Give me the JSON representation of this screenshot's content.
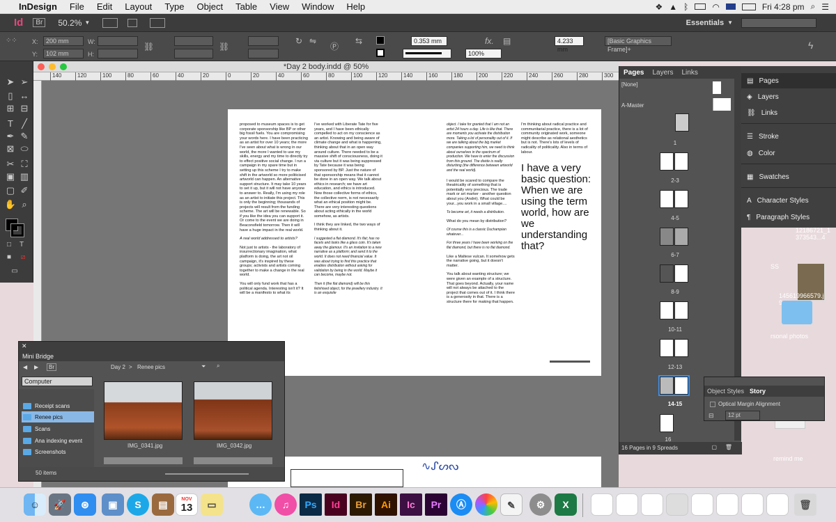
{
  "menubar": {
    "apple": "",
    "app": "InDesign",
    "items": [
      "File",
      "Edit",
      "Layout",
      "Type",
      "Object",
      "Table",
      "View",
      "Window",
      "Help"
    ],
    "battery": "",
    "flag": "",
    "clock": "Fri 4:28 pm"
  },
  "appbar": {
    "id": "Id",
    "br": "Br",
    "zoom": "50.2%",
    "workspace": "Essentials",
    "search_placeholder": ""
  },
  "control": {
    "x_label": "X:",
    "x_value": "200 mm",
    "y_label": "Y:",
    "y_value": "102 mm",
    "w_label": "W:",
    "h_label": "H:",
    "stroke_weight": "0.353 mm",
    "opacity": "100%",
    "frame_size": "4.233 mm",
    "object_style": "[Basic Graphics Frame]+"
  },
  "doc": {
    "title": "*Day 2 body.indd @ 50%",
    "ruler_ticks": [
      "140",
      "120",
      "100",
      "80",
      "60",
      "40",
      "20",
      "0",
      "20",
      "40",
      "60",
      "80",
      "100",
      "120",
      "140",
      "160",
      "180",
      "200",
      "220",
      "240",
      "260",
      "280",
      "300"
    ]
  },
  "page_left": {
    "col1": "proposed to museum spaces is to get corporate sponsorship like BP or other big fossil fuels. You are compromising your words here. I have been practicing as an artist for over 10 years; the more I've seen about what is wrong in our world, the more I wanted to use my skills, energy and my time to directly try to effect positive social change. I run a campaign in my spare time but in setting up this scheme I try to make shift in the artworld so more politicised artworld can happen. An alternative support structure. It may take 10 years to set it up, but it will not have anyone to answer to. Really, I'm using my role as an artist to initiate this project. This is only the beginning; thousands of projects will result from the funding scheme. The art will be renewable. So if you like the idea you can support it. Or come to the event we are doing in Beaconsfield tomorrow. Then it will have a huge impact in the real world.",
    "col1b": "A real world addressed to artists?",
    "col1c": "Not just to artists - the laboratory of insurrectionary imagination, what platform is doing, the art not oil campaign, it's inspired by these groups; activists and artists coming together to make a change in the real world.",
    "col1d": "You will only fund work that has a political agenda. Interesting isn't it? It will be a manifesto to what its",
    "col2": "I've worked with Liberate Tate for five years, and I have been ethically compelled to act on my conscience as an artist. Knowing and being aware of climate change and what is happening, thinking about that in an open way around culture. There needed to be a massive shift of consciousness, doing it via culture but it was being suppressed by Tate because it was being sponsored by BP. Just the nature of that sponsorship means that it cannot be done in an open way. We talk about ethics in research; we have art education, and ethics is introduced. Now those collective forms of ethics, the collective norm, is not necessarily what an ethical position might be. There are very interesting questions about acting ethically in the world somehow, as artists.",
    "col2b": "I think they are linked, the two ways of thinking about it.",
    "col2c": "I suggested a flat diamond. It's flat; has no facets and looks like a glass coin. It's taken away the glamour. It's an invitation to a new narrative as a platform; and send it to the world. It does not need financial value. It was about trying to find this practice that enables distribution without asking for validation by being in the world. Maybe it can become, maybe not.",
    "col2d": "Then it (the flat diamond) will be this fetishised object, for the jewellery industry. It is an exquisite"
  },
  "page_right": {
    "col1": "object. I take for granted that I am not an artist 24 hours a day. Life is like that. There are moments you activate the distribution more. Taking a lot of personality out of it. If we are talking about the big market companies supporting him, we need to think about ourselves in the spectrum of production. We have to enter the discussion from this ground. The divide is really disturbing (the difference between artworld and the real world).",
    "col1b": "I would be scared to compare the theatricality of something that is potentially very precious. The trade mark or art marker - another question about you (André). What could be your...you work in a small village....",
    "col1c": "To become art, it needs a distribution.",
    "col1d": "What do you mean by distribution?",
    "col1e": "Of course this is a classic Duchampian whatever...",
    "col1f": "For three years I have been working on the flat diamond, but there is no flat diamond.",
    "col1g": "Like a Maltese vulcan. It somehow gets the narrative going, but it doesn't matter.",
    "col1h": "You talk about wanting structure; we were given an example of a structure. That goes beyond. Actually, your name will not always be attached to the project that comes out of it. I think there is a generosity in that. There is a structure there for making that happen.",
    "col2": "I'm thinking about radical practice and communitarial practice, there is a lot of community originated work, someone might describe as relational aesthetics but is not. There's lots of levels of radicality of politicality. Also in terms of labour.",
    "quote": "I have a very basic question: When we are using the term world, how are we understanding that?"
  },
  "pages_panel": {
    "tabs": [
      "Pages",
      "Layers",
      "Links"
    ],
    "none": "[None]",
    "master": "A-Master",
    "spreads": [
      "1",
      "2-3",
      "4-5",
      "6-7",
      "8-9",
      "10-11",
      "12-13",
      "14-15",
      "16"
    ],
    "footer": "16 Pages in 9 Spreads"
  },
  "dock_panel": {
    "items": [
      "Pages",
      "Layers",
      "Links",
      "Stroke",
      "Color",
      "Swatches",
      "Character Styles",
      "Paragraph Styles"
    ]
  },
  "minibridge": {
    "title": "Mini Bridge",
    "path": [
      "Day 2",
      "Renee pics"
    ],
    "location": "Computer",
    "folders": [
      "Receipt scans",
      "Renee pics",
      "Scans",
      "Ana indexing event",
      "Screenshots"
    ],
    "photos": [
      "IMG_0341.jpg",
      "IMG_0342.jpg"
    ],
    "count": "50 items"
  },
  "styles_panel": {
    "tabs": [
      "Object Styles",
      "Story"
    ],
    "option": "Optical Margin Alignment",
    "size": "12 pt"
  },
  "desktop": {
    "labels": [
      "12186721_1\n373543...4",
      "SS",
      "145619966579.j\n9",
      "rsonal photos",
      "remind me"
    ]
  },
  "dock": {
    "apps": [
      "Finder",
      "Launchpad",
      "Safari",
      "Preview",
      "Skype",
      "Notes",
      "Calendar",
      "Stickies",
      "Messages",
      "iTunes",
      "Ps",
      "Id",
      "Br",
      "Ai",
      "Ic",
      "Pr",
      "App Store",
      "Photos",
      "TextEdit",
      "System Preferences",
      "Excel",
      "Trash"
    ],
    "cal_month": "NOV",
    "cal_day": "13"
  },
  "colors": {
    "accent": "#3d8ee6",
    "panel_dark": "#3c3c3c",
    "panel_mid": "#535353",
    "ps": "#0b2a46",
    "id": "#49021f",
    "br": "#2c1a03",
    "ai": "#2f1200",
    "ic": "#3c1043",
    "pr": "#2b0433"
  }
}
